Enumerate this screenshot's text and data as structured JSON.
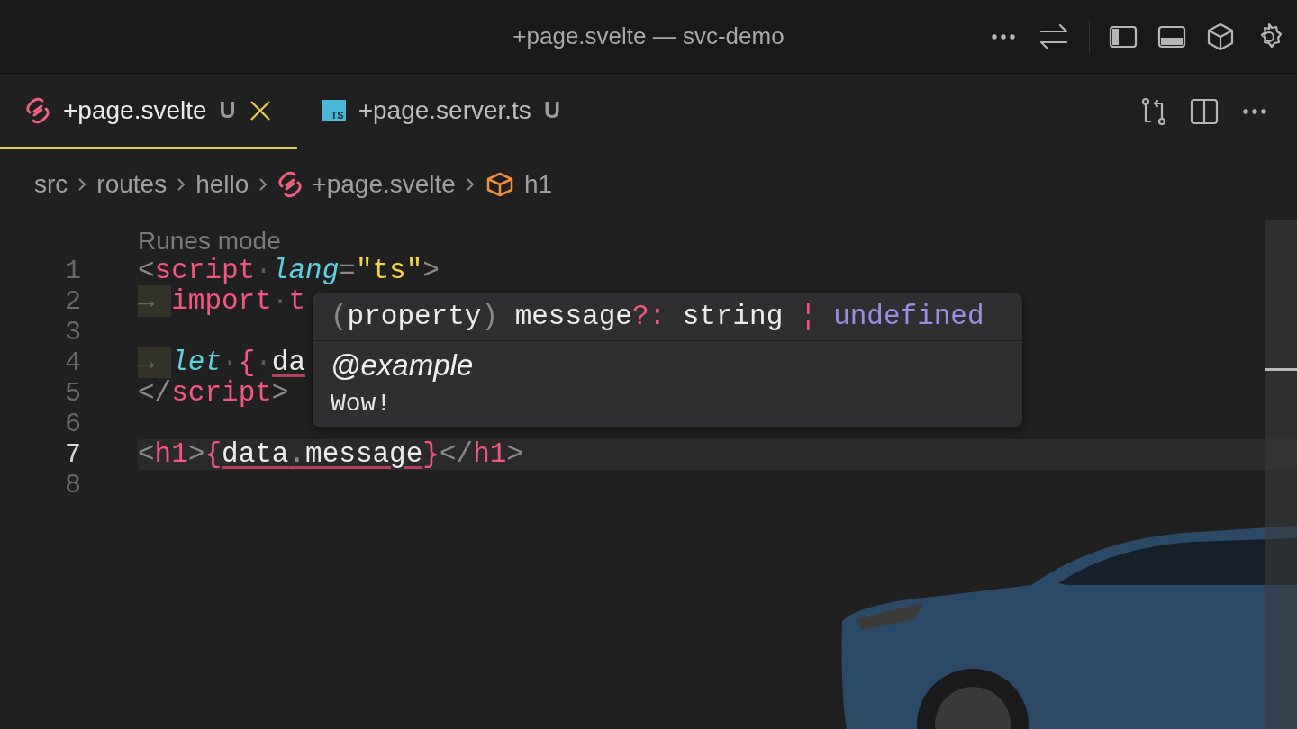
{
  "window": {
    "title": "+page.svelte — svc-demo"
  },
  "tabs": [
    {
      "label": "+page.svelte",
      "status": "U",
      "kind": "svelte",
      "selected": true
    },
    {
      "label": "+page.server.ts",
      "status": "U",
      "kind": "ts",
      "icon_text": "TS",
      "selected": false
    }
  ],
  "breadcrumbs": [
    {
      "label": "src",
      "kind": "folder"
    },
    {
      "label": "routes",
      "kind": "folder"
    },
    {
      "label": "hello",
      "kind": "folder"
    },
    {
      "label": "+page.svelte",
      "kind": "svelte"
    },
    {
      "label": "h1",
      "kind": "symbol"
    }
  ],
  "editor": {
    "codelens": "Runes mode",
    "lines": [
      {
        "number": "1",
        "current": false,
        "tokens": [
          {
            "kind": "punct",
            "text": "<"
          },
          {
            "kind": "tag",
            "text": "script"
          },
          {
            "kind": "space",
            "text": "·"
          },
          {
            "kind": "attr",
            "text": "lang"
          },
          {
            "kind": "punct",
            "text": "="
          },
          {
            "kind": "string",
            "text": "\"ts\""
          },
          {
            "kind": "punct",
            "text": ">"
          }
        ]
      },
      {
        "number": "2",
        "current": false,
        "tokens": [
          {
            "kind": "indent",
            "text": "→"
          },
          {
            "kind": "keyword",
            "text": "import"
          },
          {
            "kind": "space",
            "text": "·"
          },
          {
            "kind": "keyword",
            "text": "t"
          }
        ]
      },
      {
        "number": "3",
        "current": false
      },
      {
        "number": "4",
        "current": false,
        "tokens": [
          {
            "kind": "indent",
            "text": "→"
          },
          {
            "kind": "attr",
            "text": "let"
          },
          {
            "kind": "space",
            "text": "·"
          },
          {
            "kind": "keyword",
            "text": "{"
          },
          {
            "kind": "space",
            "text": "·"
          },
          {
            "kind": "ref",
            "text": "da"
          }
        ]
      },
      {
        "number": "5",
        "current": false,
        "tokens": [
          {
            "kind": "punct",
            "text": "</"
          },
          {
            "kind": "tag",
            "text": "script"
          },
          {
            "kind": "punct",
            "text": ">"
          }
        ]
      },
      {
        "number": "6",
        "current": false
      },
      {
        "number": "7",
        "current": true,
        "tokens": [
          {
            "kind": "punct",
            "text": "<"
          },
          {
            "kind": "tag",
            "text": "h1"
          },
          {
            "kind": "punct",
            "text": ">"
          },
          {
            "kind": "keyword",
            "text": "{"
          },
          {
            "kind": "ref",
            "text": "data"
          },
          {
            "kind": "refpunct",
            "text": "."
          },
          {
            "kind": "ref",
            "text": "message"
          },
          {
            "kind": "keyword",
            "text": "}"
          },
          {
            "kind": "punct",
            "text": "</"
          },
          {
            "kind": "tag",
            "text": "h1"
          },
          {
            "kind": "punct",
            "text": ">"
          }
        ]
      },
      {
        "number": "8",
        "current": false
      }
    ]
  },
  "hover": {
    "signature": [
      {
        "kind": "punct",
        "text": "("
      },
      {
        "kind": "text",
        "text": "property"
      },
      {
        "kind": "punct",
        "text": ")"
      },
      {
        "kind": "text",
        "text": " message"
      },
      {
        "kind": "keyword",
        "text": "?:"
      },
      {
        "kind": "text",
        "text": " string "
      },
      {
        "kind": "keyword",
        "text": "¦"
      },
      {
        "kind": "type",
        "text": " undefined"
      }
    ],
    "tag": "@example",
    "example": "Wow!"
  }
}
